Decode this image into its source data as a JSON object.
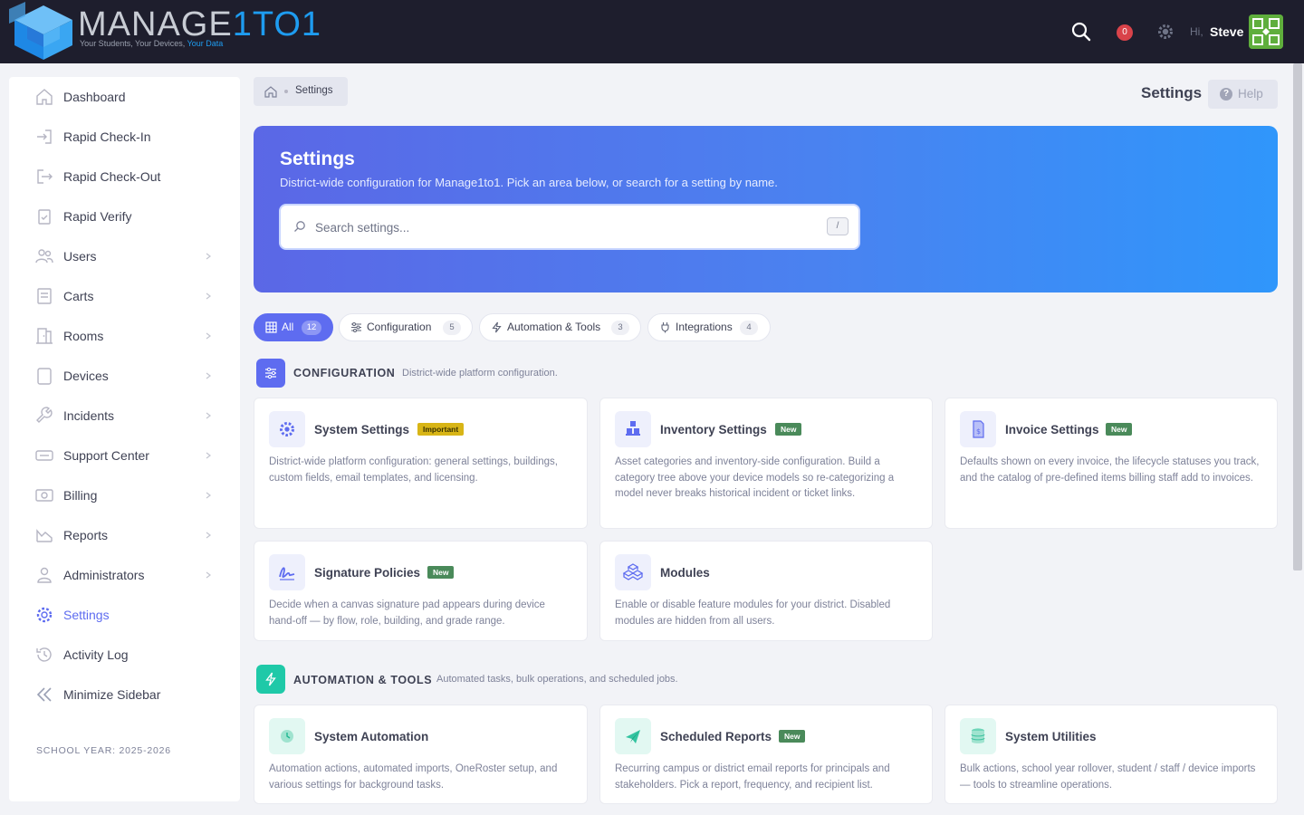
{
  "header": {
    "logo_word": "MANAGE",
    "logo_number": "1TO1",
    "logo_tagline_a": "Your Students, Your Devices, ",
    "logo_tagline_b": "Your Data",
    "notification_count": "0",
    "greeting": "Hi,",
    "user_name": "Steve",
    "icons": [
      "search-icon",
      "bell-badge",
      "gear-icon",
      "avatar"
    ]
  },
  "sidebar": {
    "items": [
      {
        "label": "Dashboard",
        "icon": "home-icon"
      },
      {
        "label": "Rapid Check-In",
        "icon": "login-icon"
      },
      {
        "label": "Rapid Check-Out",
        "icon": "logout-icon"
      },
      {
        "label": "Rapid Verify",
        "icon": "clipboard-check-icon"
      },
      {
        "label": "Users",
        "icon": "users-icon"
      },
      {
        "label": "Carts",
        "icon": "cart-icon"
      },
      {
        "label": "Rooms",
        "icon": "door-icon"
      },
      {
        "label": "Devices",
        "icon": "tablet-icon"
      },
      {
        "label": "Incidents",
        "icon": "wrench-icon"
      },
      {
        "label": "Support Center",
        "icon": "support-icon"
      },
      {
        "label": "Billing",
        "icon": "money-icon"
      },
      {
        "label": "Reports",
        "icon": "chart-icon"
      },
      {
        "label": "Administrators",
        "icon": "admin-icon"
      },
      {
        "label": "Settings",
        "icon": "gear-icon"
      },
      {
        "label": "Activity Log",
        "icon": "history-icon"
      },
      {
        "label": "Minimize Sidebar",
        "icon": "double-chevron-left-icon"
      }
    ],
    "school_year": "SCHOOL YEAR: 2025-2026"
  },
  "breadcrumb": {
    "current": "Settings"
  },
  "page": {
    "title": "Settings",
    "help_label": "Help"
  },
  "hero": {
    "title": "Settings",
    "description": "District-wide configuration for Manage1to1. Pick an area below, or search for a setting by name.",
    "search_placeholder": "Search settings...",
    "search_shortcut": "/"
  },
  "filters": [
    {
      "label": "All",
      "count": "12",
      "active": true
    },
    {
      "label": "Configuration",
      "count": "5"
    },
    {
      "label": "Automation & Tools",
      "count": "3"
    },
    {
      "label": "Integrations",
      "count": "4"
    }
  ],
  "sections": {
    "configuration": {
      "title": "CONFIGURATION",
      "description": "District-wide platform configuration.",
      "color": "#5e6cf0",
      "cards": [
        {
          "title": "System Settings",
          "badge": "Important",
          "desc": "District-wide platform configuration: general settings, buildings, custom fields, email templates, and licensing."
        },
        {
          "title": "Inventory Settings",
          "badge": "New",
          "desc": "Asset categories and inventory-side configuration. Build a category tree above your device models so re-categorizing a model never breaks historical incident or ticket links."
        },
        {
          "title": "Invoice Settings",
          "badge": "New",
          "desc": "Defaults shown on every invoice, the lifecycle statuses you track, and the catalog of pre-defined items billing staff add to invoices."
        },
        {
          "title": "Signature Policies",
          "badge": "New",
          "desc": "Decide when a canvas signature pad appears during device hand-off — by flow, role, building, and grade range."
        },
        {
          "title": "Modules",
          "badge": "",
          "desc": "Enable or disable feature modules for your district. Disabled modules are hidden from all users."
        }
      ]
    },
    "automation": {
      "title": "AUTOMATION & TOOLS",
      "description": "Automated tasks, bulk operations, and scheduled jobs.",
      "color": "#1fc9a8",
      "cards": [
        {
          "title": "System Automation",
          "badge": "",
          "desc": "Automation actions, automated imports, OneRoster setup, and various settings for background tasks."
        },
        {
          "title": "Scheduled Reports",
          "badge": "New",
          "desc": "Recurring campus or district email reports for principals and stakeholders. Pick a report, frequency, and recipient list."
        },
        {
          "title": "System Utilities",
          "badge": "",
          "desc": "Bulk actions, school year rollover, student / staff / device imports — tools to streamline operations."
        }
      ]
    }
  },
  "colors": {
    "accent": "#5e6cf0",
    "header_bg": "#1e1e2d",
    "badge_new": "#4a8a5a",
    "badge_important": "#d8b516"
  }
}
